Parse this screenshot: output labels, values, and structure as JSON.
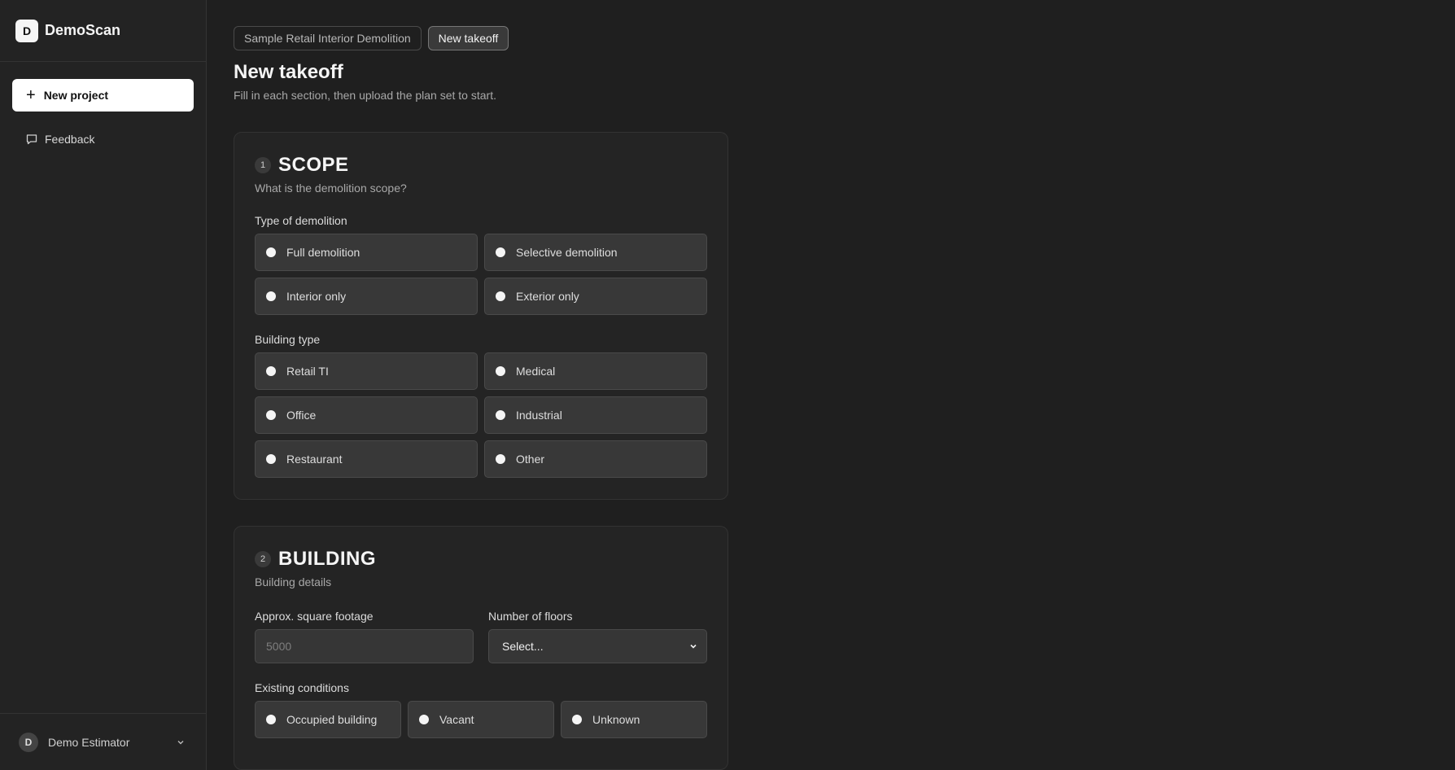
{
  "brand": {
    "logo_letter": "D",
    "name": "DemoScan"
  },
  "sidebar": {
    "new_project_label": "New project",
    "feedback_label": "Feedback",
    "user": {
      "initial": "D",
      "name": "Demo Estimator"
    }
  },
  "breadcrumbs": [
    "Sample Retail Interior Demolition",
    "New takeoff"
  ],
  "page": {
    "title": "New takeoff",
    "subtitle": "Fill in each section, then upload the plan set to start."
  },
  "scope": {
    "step": "1",
    "title": "SCOPE",
    "subtitle": "What is the demolition scope?",
    "demolition_label": "Type of demolition",
    "demolition_options": [
      "Full demolition",
      "Selective demolition",
      "Interior only",
      "Exterior only"
    ],
    "building_type_label": "Building type",
    "building_type_options": [
      "Retail TI",
      "Medical",
      "Office",
      "Industrial",
      "Restaurant",
      "Other"
    ]
  },
  "building": {
    "step": "2",
    "title": "BUILDING",
    "subtitle": "Building details",
    "sqft_label": "Approx. square footage",
    "sqft_placeholder": "5000",
    "floors_label": "Number of floors",
    "floors_value": "Select...",
    "conditions_label": "Existing conditions",
    "conditions_options": [
      "Occupied building",
      "Vacant",
      "Unknown"
    ]
  }
}
